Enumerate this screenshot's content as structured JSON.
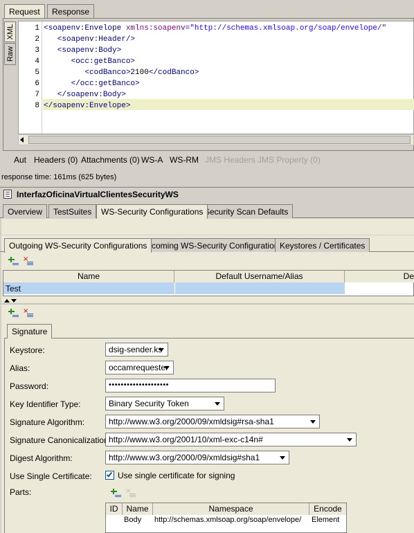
{
  "request_tabs": [
    "Request",
    "Response"
  ],
  "side_tabs": [
    "XML",
    "Raw"
  ],
  "code_lines": [
    {
      "num": "1",
      "parts": [
        [
          "tag",
          "<soapenv:Envelope "
        ],
        [
          "attr",
          "xmlns:soapenv"
        ],
        [
          "tag",
          "="
        ],
        [
          "val",
          "\"http://schemas.xmlsoap.org/soap/envelope/\""
        ]
      ]
    },
    {
      "num": "2",
      "parts": [
        [
          "tag",
          "   <soapenv:Header/>"
        ]
      ]
    },
    {
      "num": "3",
      "parts": [
        [
          "tag",
          "   <soapenv:Body>"
        ]
      ]
    },
    {
      "num": "4",
      "parts": [
        [
          "tag",
          "      <occ:getBanco>"
        ]
      ]
    },
    {
      "num": "5",
      "parts": [
        [
          "tag",
          "         <codBanco>"
        ],
        [
          "txt",
          "2100"
        ],
        [
          "tag",
          "</codBanco>"
        ]
      ]
    },
    {
      "num": "6",
      "parts": [
        [
          "tag",
          "      </occ:getBanco>"
        ]
      ]
    },
    {
      "num": "7",
      "parts": [
        [
          "tag",
          "   </soapenv:Body>"
        ]
      ]
    },
    {
      "num": "8",
      "parts": [
        [
          "tag",
          "</soapenv:Envelope>"
        ]
      ]
    }
  ],
  "bottom_tabs": [
    {
      "label": "Aut",
      "enabled": true
    },
    {
      "label": "Headers (0)",
      "enabled": true
    },
    {
      "label": "Attachments (0)",
      "enabled": true
    },
    {
      "label": "WS-A",
      "enabled": true
    },
    {
      "label": "WS-RM",
      "enabled": true
    },
    {
      "label": "JMS Headers",
      "enabled": false
    },
    {
      "label": "JMS Property (0)",
      "enabled": false
    }
  ],
  "response_time": "response time: 161ms (625 bytes)",
  "project_title": "InterfazOficinaVirtualClientesSecurityWS",
  "project_tabs": [
    "Overview",
    "TestSuites",
    "WS-Security Configurations",
    "Security Scan Defaults"
  ],
  "wss_tabs": [
    "Outgoing WS-Security Configurations",
    "Incoming WS-Security Configurations",
    "Keystores / Certificates"
  ],
  "config_table": {
    "headers": [
      "Name",
      "Default Username/Alias",
      "De"
    ],
    "rows": [
      [
        "Test",
        "",
        ""
      ]
    ]
  },
  "signature_tab": "Signature",
  "form": {
    "keystore_label": "Keystore:",
    "keystore_value": "dsig-sender.ks",
    "alias_label": "Alias:",
    "alias_value": "occamrequester",
    "password_label": "Password:",
    "password_value": "••••••••••••••••••••",
    "key_id_label": "Key Identifier Type:",
    "key_id_value": "Binary Security Token",
    "sig_alg_label": "Signature Algorithm:",
    "sig_alg_value": "http://www.w3.org/2000/09/xmldsig#rsa-sha1",
    "sig_canon_label": "Signature Canonicalization:",
    "sig_canon_value": "http://www.w3.org/2001/10/xml-exc-c14n#",
    "digest_label": "Digest Algorithm:",
    "digest_value": "http://www.w3.org/2000/09/xmldsig#sha1",
    "single_cert_label": "Use Single Certificate:",
    "single_cert_check": "Use single certificate for signing",
    "parts_label": "Parts:"
  },
  "parts_table": {
    "headers": [
      "ID",
      "Name",
      "Namespace",
      "Encode"
    ],
    "rows": [
      [
        "",
        "Body",
        "http://schemas.xmlsoap.org/soap/envelope/",
        "Element"
      ]
    ]
  }
}
